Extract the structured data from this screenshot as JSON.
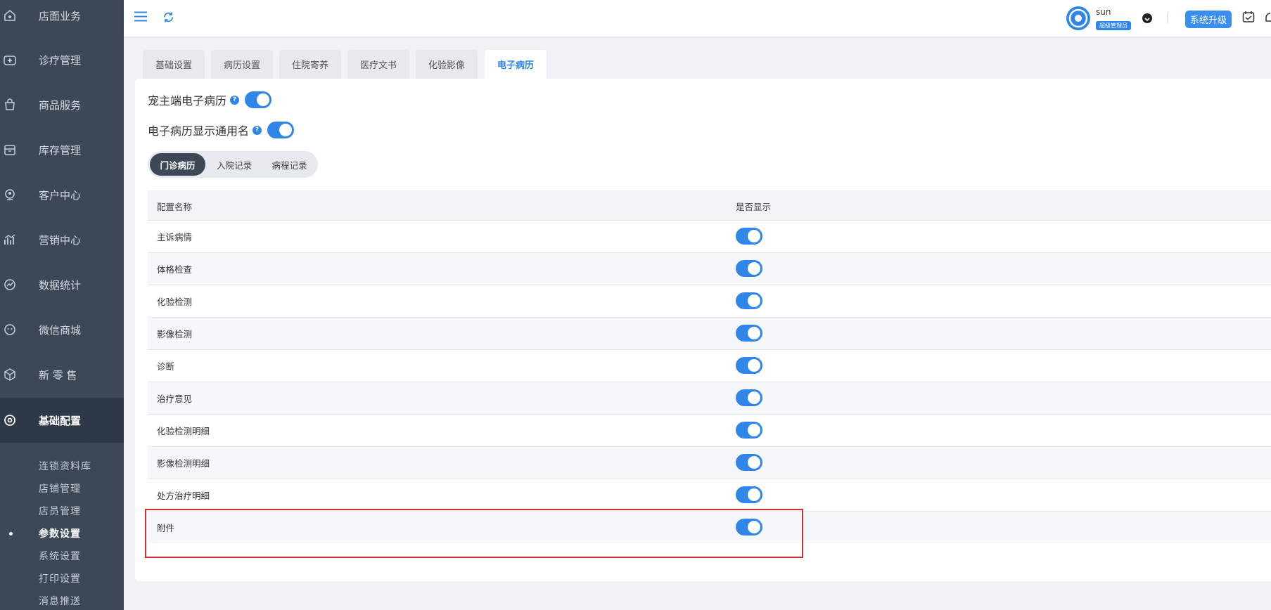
{
  "sidebar": {
    "items": [
      {
        "label": "店面业务",
        "icon": "store-icon"
      },
      {
        "label": "诊疗管理",
        "icon": "medical-kit-icon"
      },
      {
        "label": "商品服务",
        "icon": "shopping-bag-icon"
      },
      {
        "label": "库存管理",
        "icon": "inventory-box-icon"
      },
      {
        "label": "客户中心",
        "icon": "customer-icon"
      },
      {
        "label": "营销中心",
        "icon": "marketing-chart-icon"
      },
      {
        "label": "数据统计",
        "icon": "statistics-icon"
      },
      {
        "label": "微信商城",
        "icon": "wechat-icon"
      },
      {
        "label": "新 零 售",
        "icon": "cube-icon"
      },
      {
        "label": "基础配置",
        "icon": "gear-icon"
      }
    ],
    "sub_items": [
      "连锁资料库",
      "店铺管理",
      "店员管理",
      "参数设置",
      "系统设置",
      "打印设置",
      "消息推送"
    ]
  },
  "header": {
    "username": "sun",
    "role": "超级管理员",
    "upgrade_label": "系统升级"
  },
  "tabs": [
    "基础设置",
    "病历设置",
    "住院寄养",
    "医疗文书",
    "化验影像",
    "电子病历"
  ],
  "settings": {
    "owner_emr": "宠主端电子病历",
    "emr_generic_name": "电子病历显示通用名"
  },
  "segments": [
    "门诊病历",
    "入院记录",
    "病程记录"
  ],
  "table": {
    "col_name": "配置名称",
    "col_show": "是否显示",
    "rows": [
      {
        "name": "主诉病情",
        "shown": true
      },
      {
        "name": "体格检查",
        "shown": true
      },
      {
        "name": "化验检测",
        "shown": true
      },
      {
        "name": "影像检测",
        "shown": true
      },
      {
        "name": "诊断",
        "shown": true
      },
      {
        "name": "治疗意见",
        "shown": true
      },
      {
        "name": "化验检测明细",
        "shown": true
      },
      {
        "name": "影像检测明细",
        "shown": true
      },
      {
        "name": "处方治疗明细",
        "shown": true
      },
      {
        "name": "附件",
        "shown": true
      }
    ]
  },
  "colors": {
    "accent": "#2f86e8",
    "sidebar": "#3d4756",
    "highlight": "#d32f2f"
  }
}
